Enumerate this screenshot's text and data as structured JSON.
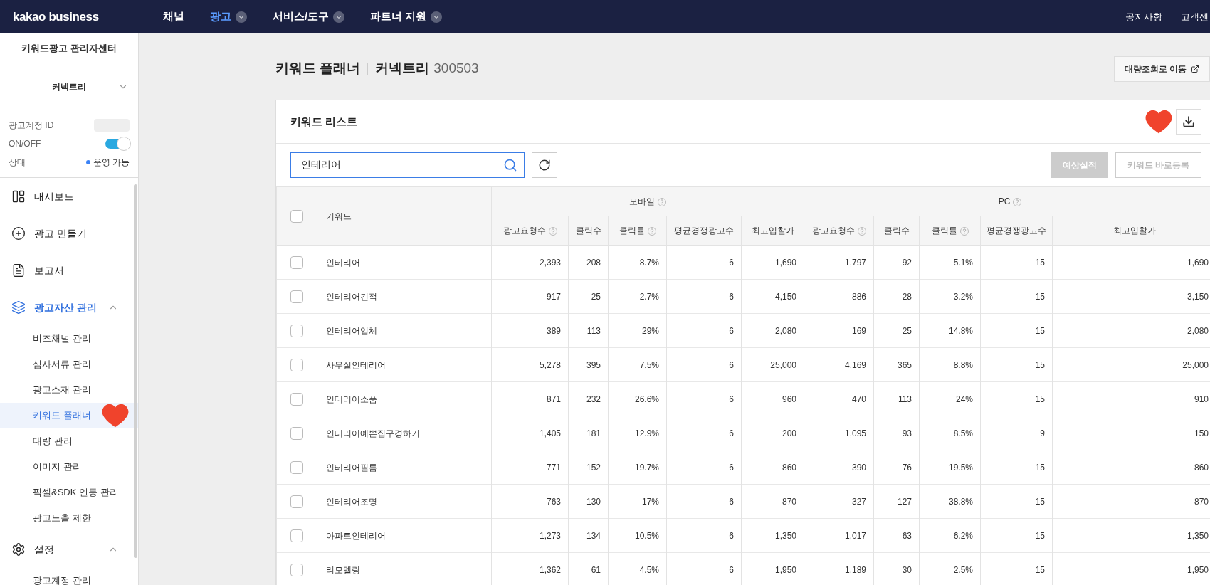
{
  "topbar": {
    "logo": "kakao business",
    "nav": [
      {
        "label": "채널",
        "selected": false,
        "dropdown": false
      },
      {
        "label": "광고",
        "selected": true,
        "dropdown": true
      },
      {
        "label": "서비스/도구",
        "selected": false,
        "dropdown": true
      },
      {
        "label": "파트너 지원",
        "selected": false,
        "dropdown": true
      }
    ],
    "links": [
      "공지사항",
      "고객센"
    ]
  },
  "sidebar": {
    "title": "키워드광고 관리자센터",
    "account": "커넥트리",
    "fields": [
      {
        "kind": "masked",
        "label": "광고계정 ID"
      },
      {
        "kind": "toggle",
        "label": "ON/OFF",
        "on": true
      },
      {
        "kind": "status",
        "label": "상태",
        "value": "운영 가능",
        "color": "#3b82f6"
      }
    ],
    "items": [
      {
        "label": "대시보드",
        "selected": false
      },
      {
        "label": "광고 만들기",
        "selected": false
      },
      {
        "label": "보고서",
        "selected": false
      },
      {
        "label": "광고자산 관리",
        "selected": true,
        "expanded": true,
        "children": [
          {
            "label": "비즈채널 관리",
            "selected": false
          },
          {
            "label": "심사서류 관리",
            "selected": false
          },
          {
            "label": "광고소재 관리",
            "selected": false
          },
          {
            "label": "키워드 플래너",
            "selected": true,
            "heart": true
          },
          {
            "label": "대량 관리",
            "selected": false
          },
          {
            "label": "이미지 관리",
            "selected": false
          },
          {
            "label": "픽셀&SDK 연동 관리",
            "selected": false
          },
          {
            "label": "광고노출 제한",
            "selected": false
          }
        ]
      },
      {
        "label": "설정",
        "selected": false,
        "expanded": true,
        "children": [
          {
            "label": "광고계정 관리",
            "selected": false
          }
        ]
      }
    ]
  },
  "page": {
    "title": "키워드 플래너",
    "account": "커넥트리",
    "account_id": "300503",
    "bulk_button": "대량조회로 이동"
  },
  "card": {
    "title": "키워드 리스트",
    "heart": true,
    "search": {
      "value": "인테리어"
    },
    "buttons": [
      {
        "label": "예상실적",
        "disabled": true,
        "kind": "filled"
      },
      {
        "label": "키워드 바로등록",
        "disabled": true,
        "kind": "outline"
      }
    ]
  },
  "table": {
    "header_checked": false,
    "keyword_column": "키워드",
    "groups": [
      {
        "label": "모바일",
        "help": true
      },
      {
        "label": "PC",
        "help": true
      }
    ],
    "columns": [
      {
        "label": "광고요청수",
        "help": true
      },
      {
        "label": "클릭수",
        "help": false
      },
      {
        "label": "클릭률",
        "help": true
      },
      {
        "label": "평균경쟁광고수",
        "help": false
      },
      {
        "label": "최고입찰가",
        "help": false
      },
      {
        "label": "광고요청수",
        "help": true
      },
      {
        "label": "클릭수",
        "help": false
      },
      {
        "label": "클릭률",
        "help": true
      },
      {
        "label": "평균경쟁광고수",
        "help": false
      },
      {
        "label": "최고입찰가",
        "help": false
      }
    ],
    "rows": [
      {
        "checked": false,
        "keyword": "인테리어",
        "values": [
          "2,393",
          "208",
          "8.7%",
          "6",
          "1,690",
          "1,797",
          "92",
          "5.1%",
          "15",
          "1,690"
        ]
      },
      {
        "checked": false,
        "keyword": "인테리어견적",
        "values": [
          "917",
          "25",
          "2.7%",
          "6",
          "4,150",
          "886",
          "28",
          "3.2%",
          "15",
          "3,150"
        ]
      },
      {
        "checked": false,
        "keyword": "인테리어업체",
        "values": [
          "389",
          "113",
          "29%",
          "6",
          "2,080",
          "169",
          "25",
          "14.8%",
          "15",
          "2,080"
        ]
      },
      {
        "checked": false,
        "keyword": "사무실인테리어",
        "values": [
          "5,278",
          "395",
          "7.5%",
          "6",
          "25,000",
          "4,169",
          "365",
          "8.8%",
          "15",
          "25,000"
        ]
      },
      {
        "checked": false,
        "keyword": "인테리어소품",
        "values": [
          "871",
          "232",
          "26.6%",
          "6",
          "960",
          "470",
          "113",
          "24%",
          "15",
          "910"
        ]
      },
      {
        "checked": false,
        "keyword": "인테리어예쁜집구경하기",
        "values": [
          "1,405",
          "181",
          "12.9%",
          "6",
          "200",
          "1,095",
          "93",
          "8.5%",
          "9",
          "150"
        ]
      },
      {
        "checked": false,
        "keyword": "인테리어필름",
        "values": [
          "771",
          "152",
          "19.7%",
          "6",
          "860",
          "390",
          "76",
          "19.5%",
          "15",
          "860"
        ]
      },
      {
        "checked": false,
        "keyword": "인테리어조명",
        "values": [
          "763",
          "130",
          "17%",
          "6",
          "870",
          "327",
          "127",
          "38.8%",
          "15",
          "870"
        ]
      },
      {
        "checked": false,
        "keyword": "아파트인테리어",
        "values": [
          "1,273",
          "134",
          "10.5%",
          "6",
          "1,350",
          "1,017",
          "63",
          "6.2%",
          "15",
          "1,350"
        ]
      },
      {
        "checked": false,
        "keyword": "리모델링",
        "values": [
          "1,362",
          "61",
          "4.5%",
          "6",
          "1,950",
          "1,189",
          "30",
          "2.5%",
          "15",
          "1,950"
        ]
      }
    ]
  }
}
